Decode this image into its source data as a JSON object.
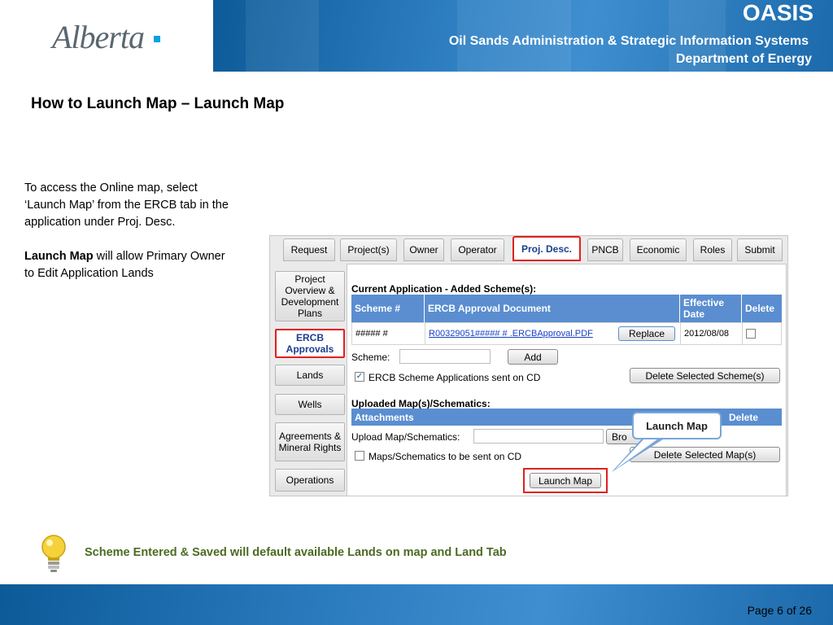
{
  "header": {
    "logo_text": "Alberta",
    "app_name": "OASIS",
    "subtitle": "Oil Sands Administration & Strategic Information Systems",
    "department": "Department of Energy"
  },
  "title": "How to Launch Map – Launch Map",
  "description": {
    "para1": "To access the Online map, select ‘Launch Map’ from the ERCB tab in the application under Proj. Desc.",
    "para2_bold": "Launch Map",
    "para2_rest": " will allow Primary Owner to Edit Application Lands"
  },
  "tabs": [
    {
      "label": "Request"
    },
    {
      "label": "Project(s)"
    },
    {
      "label": "Owner"
    },
    {
      "label": "Operator"
    },
    {
      "label": "Proj. Desc."
    },
    {
      "label": "PNCB"
    },
    {
      "label": "Economic"
    },
    {
      "label": "Roles"
    },
    {
      "label": "Submit"
    }
  ],
  "side_nav": [
    {
      "label": "Project Overview & Development Plans"
    },
    {
      "label": "ERCB Approvals"
    },
    {
      "label": "Lands"
    },
    {
      "label": "Wells"
    },
    {
      "label": "Agreements & Mineral Rights"
    },
    {
      "label": "Operations"
    }
  ],
  "schemes": {
    "heading": "Current Application - Added Scheme(s):",
    "columns": [
      "Scheme #",
      "ERCB Approval Document",
      "Effective Date",
      "Delete"
    ],
    "row": {
      "scheme": "##### #",
      "document": "R00329051##### # .ERCBApproval.PDF",
      "replace_label": "Replace",
      "date": "2012/08/08"
    },
    "scheme_label": "Scheme:",
    "add_label": "Add",
    "cd_label": "ERCB Scheme Applications sent on CD",
    "cd_checked": true,
    "delete_label": "Delete Selected Scheme(s)"
  },
  "maps": {
    "heading": "Uploaded Map(s)/Schematics:",
    "columns": [
      "Attachments",
      "Delete"
    ],
    "upload_label": "Upload Map/Schematics:",
    "browse_label": "Bro",
    "cd_label": "Maps/Schematics to be sent on CD",
    "delete_label": "Delete Selected Map(s)",
    "launch_label": "Launch Map"
  },
  "callout": "Launch Map",
  "tip": "Scheme Entered & Saved will default available Lands on map and Land Tab",
  "footer": {
    "page": "Page 6 of 26"
  }
}
